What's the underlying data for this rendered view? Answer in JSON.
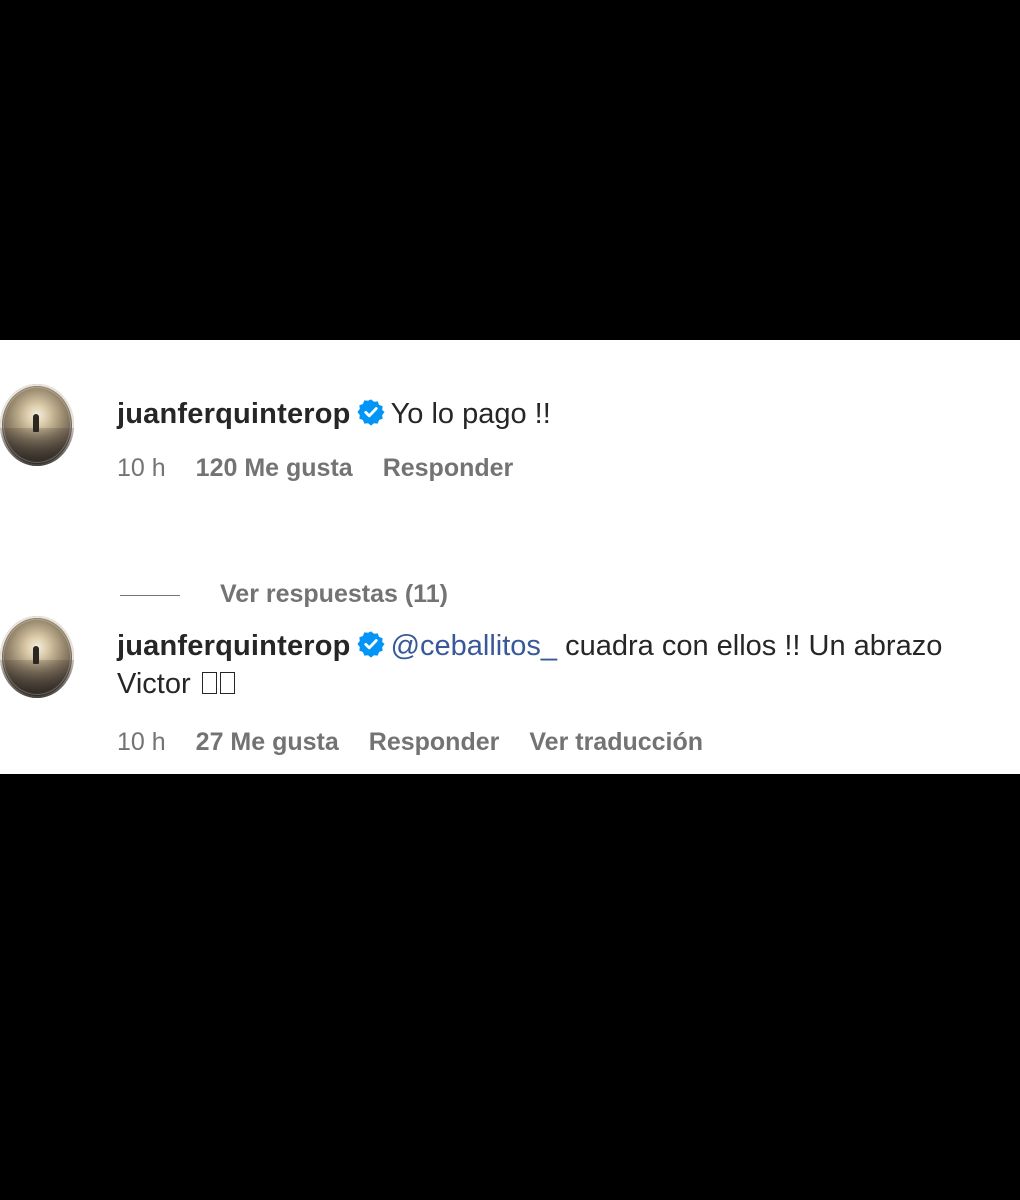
{
  "comments": [
    {
      "username": "juanferquinterop",
      "verified": true,
      "text": "Yo lo pago !!",
      "time": "10 h",
      "likes": "120 Me gusta",
      "reply_label": "Responder",
      "view_replies": "Ver respuestas (11)"
    },
    {
      "username": "juanferquinterop",
      "verified": true,
      "mention": "@ceballitos_",
      "text": " cuadra con ellos !! Un abrazo",
      "text_line2": "Victor",
      "time": "10 h",
      "likes": "27 Me gusta",
      "reply_label": "Responder",
      "translate_label": "Ver traducción"
    }
  ],
  "icons": {
    "verified": "verified-badge-icon",
    "avatar": "profile-avatar"
  },
  "colors": {
    "background": "#000000",
    "panel": "#ffffff",
    "text_primary": "#262626",
    "text_secondary": "#737373",
    "mention": "#385898",
    "verified_blue": "#0095f6"
  }
}
